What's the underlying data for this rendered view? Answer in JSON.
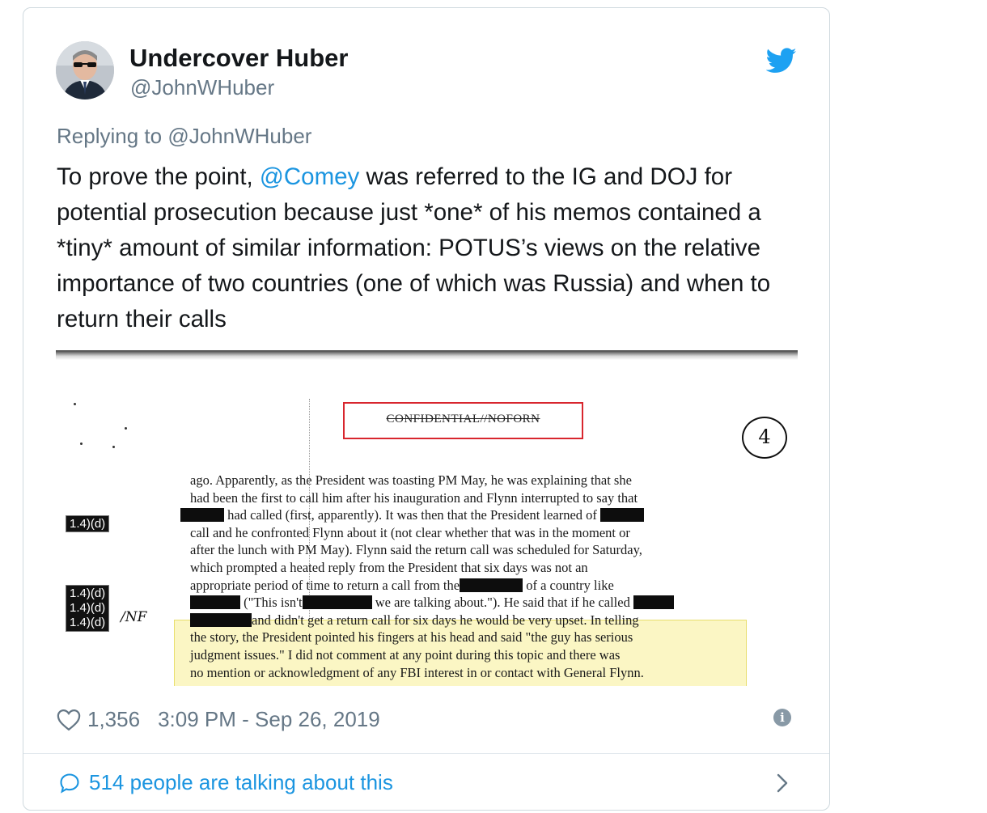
{
  "tweet": {
    "author_name": "Undercover Huber",
    "author_handle": "@JohnWHuber",
    "replying_prefix": "Replying to",
    "replying_to": "@JohnWHuber",
    "text_before_mention": "To prove the point, ",
    "mention": "@Comey",
    "text_after_mention": " was referred to the IG and DOJ for potential prosecution because just *one* of his memos contained a *tiny* amount of similar information: POTUS’s views on the relative importance of two countries (one of which was Russia) and when to return their calls",
    "likes": "1,356",
    "timestamp": "3:09 PM - Sep 26, 2019",
    "talking_about": "514 people are talking about this"
  },
  "document": {
    "classification": "CONFIDENTIAL//NOFORN",
    "page_number": "4",
    "tag_single": "1.4)(d)",
    "tag_stack": [
      "1.4)(d)",
      "1.4)(d)",
      "1.4)(d)"
    ],
    "nf_mark": "/NF",
    "lines": [
      "ago.  Apparently, as the President was toasting PM May, he was explaining that she",
      "had been the first to call him after his inauguration and Flynn interrupted to say that",
      "had called (first, apparently).  It was then that the President learned of",
      "call and he confronted Flynn about it (not clear whether that was in the moment or",
      "after the lunch with PM May).  Flynn said the return call was scheduled for Saturday,",
      "which prompted a heated reply from the President that six days was not an",
      "appropriate period of time to return a call from the",
      "of a country like",
      "(\"This isn't",
      "we are talking about.\").  He said that if he called",
      "and didn't get a return call for six days he would be very upset.  In telling",
      "the story, the President pointed his fingers at his head and said \"the guy has serious",
      "judgment issues.\"  I did not comment at any point during this topic and there was",
      "no mention or acknowledgment of any FBI interest in or contact with General Flynn."
    ]
  },
  "colors": {
    "link": "#1b95e0",
    "secondary": "#657786",
    "border": "#cfd9de",
    "highlight": "#fbf6c4",
    "stamp_red": "#d8262e"
  },
  "icons": [
    "twitter-bird-icon",
    "heart-icon",
    "info-icon",
    "speech-bubble-icon",
    "chevron-right-icon"
  ]
}
